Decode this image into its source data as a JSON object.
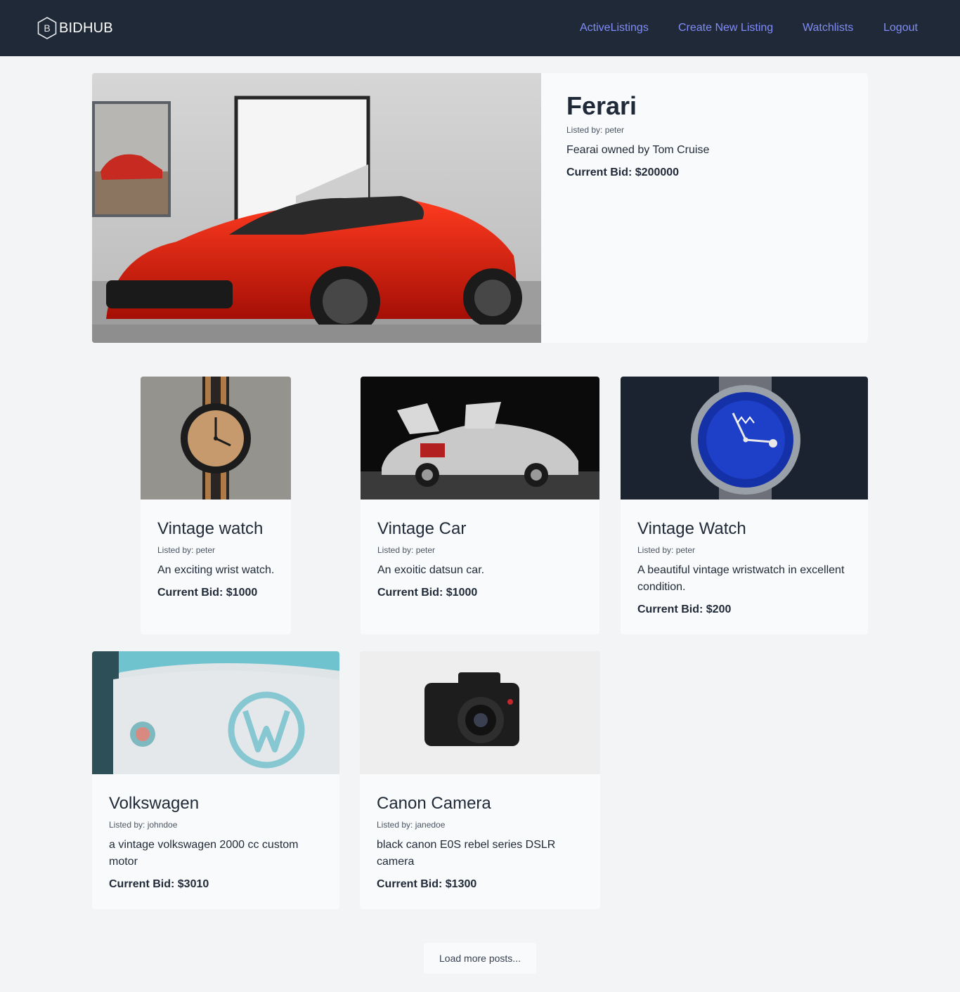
{
  "nav": {
    "brand_letter": "B",
    "brand": "BIDHUB",
    "links": [
      "ActiveListings",
      "Create New Listing",
      "Watchlists",
      "Logout"
    ]
  },
  "featured": {
    "title": "Ferari",
    "listed_by": "Listed by: peter",
    "description": "Fearai owned by Tom Cruise",
    "bid": "Current Bid: $200000"
  },
  "listings": [
    {
      "title": "Vintage watch",
      "listed_by": "Listed by: peter",
      "description": "An exciting wrist watch.",
      "bid": "Current Bid: $1000"
    },
    {
      "title": "Vintage Car",
      "listed_by": "Listed by: peter",
      "description": "An exoitic datsun car.",
      "bid": "Current Bid: $1000"
    },
    {
      "title": "Vintage Watch",
      "listed_by": "Listed by: peter",
      "description": "A beautiful vintage wristwatch in excellent condition.",
      "bid": "Current Bid: $200"
    },
    {
      "title": "Volkswagen",
      "listed_by": "Listed by: johndoe",
      "description": "a vintage volkswagen 2000 cc custom motor",
      "bid": "Current Bid: $3010"
    },
    {
      "title": "Canon Camera",
      "listed_by": "Listed by: janedoe",
      "description": "black canon E0S rebel series DSLR camera",
      "bid": "Current Bid: $1300"
    }
  ],
  "load_more": "Load more posts...",
  "colors": {
    "nav_bg": "#1f2937",
    "link": "#818cf8",
    "page_bg": "#f3f4f6",
    "card_bg": "#f9fafb"
  }
}
